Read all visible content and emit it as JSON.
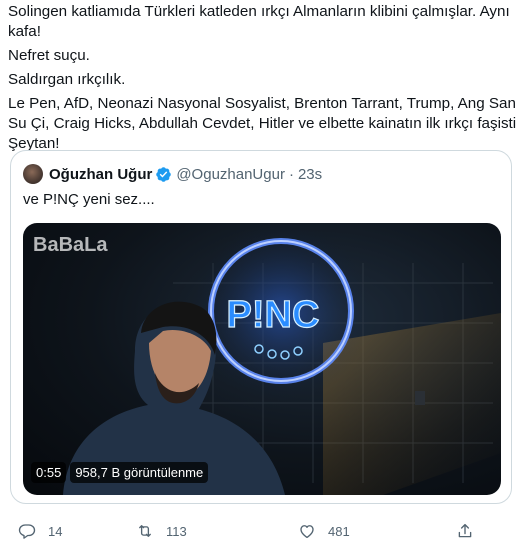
{
  "tweet": {
    "lines": [
      "Solingen katliamıda Türkleri katleden ırkçı Almanların klibini çalmışlar. Aynı",
      "kafa!",
      "Nefret suçu.",
      "Saldırgan ırkçılık.",
      "Le Pen, AfD, Neonazi Nasyonal Sosyalist, Brenton Tarrant, Trump, Ang San",
      "Su Çi, Craig Hicks, Abdullah Cevdet, Hitler ve elbette kainatın ilk ırkçı faşisti",
      "Şeytan!"
    ]
  },
  "quote": {
    "name": "Oğuzhan Uğur",
    "handle": "@OguzhanUgur",
    "separator": "·",
    "time": "23s",
    "text": "ve P!NÇ yeni sez....",
    "video": {
      "watermark": "BaBaLa",
      "sign_text": "P!NC",
      "duration": "0:55",
      "views": "958,7 B görüntülenme"
    }
  },
  "actions": {
    "reply_count": "14",
    "retweet_count": "113",
    "like_count": "481"
  },
  "colors": {
    "text": "#0f1419",
    "secondary": "#536471",
    "verified": "#1d9bf0",
    "border": "#cfd9de",
    "neon": "#1e6bff"
  },
  "icons": [
    "avatar",
    "verified-badge-icon",
    "reply-icon",
    "retweet-icon",
    "like-icon",
    "share-icon"
  ]
}
